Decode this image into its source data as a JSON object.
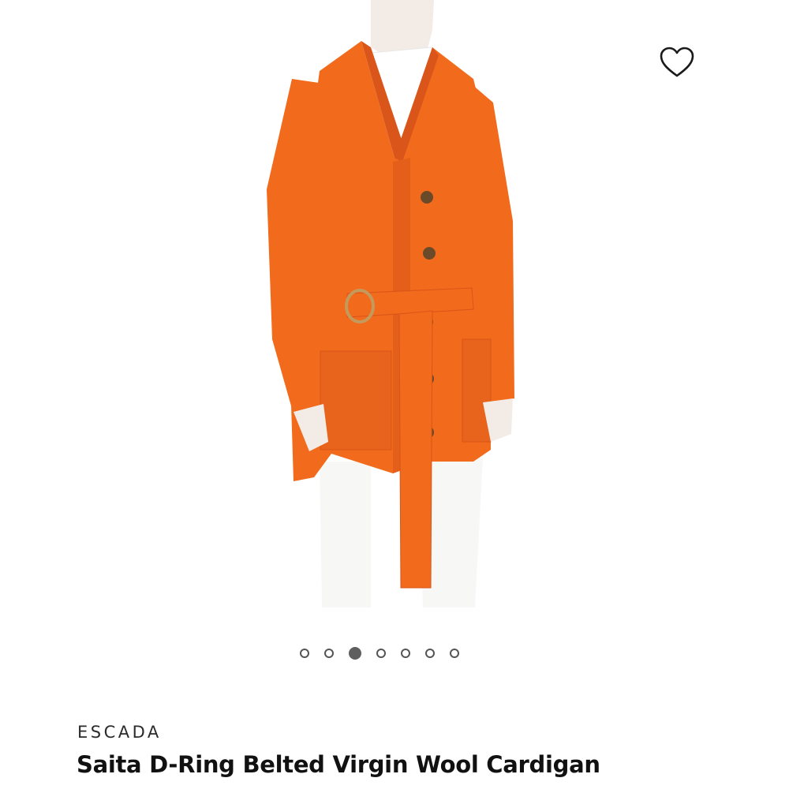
{
  "product": {
    "brand": "ESCADA",
    "title": "Saita D-Ring Belted Virgin Wool Cardigan",
    "image_alt": "Orange ribbed cardigan with D-ring belt worn over white top and white trousers",
    "favorite_icon": "heart-outline-icon"
  },
  "carousel": {
    "count": 7,
    "active_index": 2
  },
  "colors": {
    "garment": "#f26a1b",
    "garment_shadow": "#d9551a",
    "text_primary": "#111111",
    "dot": "#555555"
  }
}
